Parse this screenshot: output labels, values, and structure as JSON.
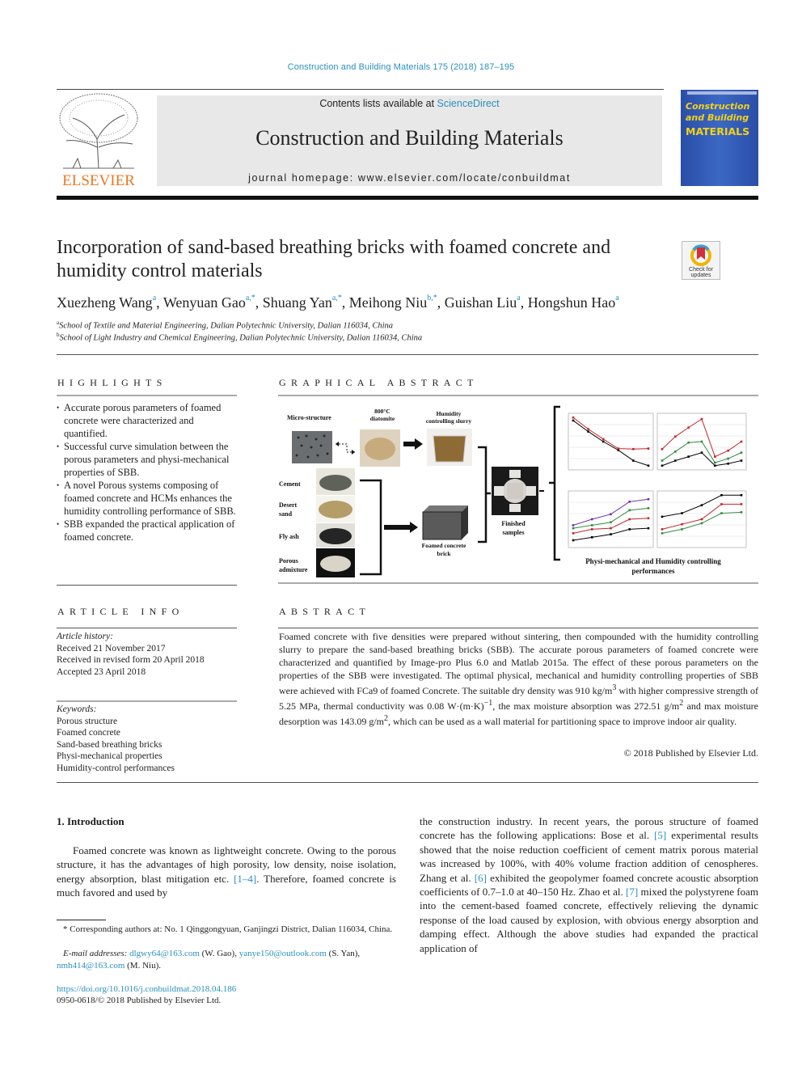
{
  "header": {
    "citation": "Construction and Building Materials 175 (2018) 187–195",
    "contents_prefix": "Contents lists available at ",
    "contents_link": "ScienceDirect",
    "journal_title": "Construction and Building Materials",
    "homepage": "journal homepage: www.elsevier.com/locate/conbuildmat",
    "publisher_logo": "ELSEVIER",
    "cover": {
      "line1": "Construction",
      "line2": "and Building",
      "line3": "MATERIALS"
    }
  },
  "article": {
    "title": "Incorporation of sand-based breathing bricks with foamed concrete and humidity control materials",
    "check_updates": "Check for updates",
    "authors": [
      {
        "name": "Xuezheng Wang",
        "sup": "a"
      },
      {
        "name": "Wenyuan Gao",
        "sup": "a,*"
      },
      {
        "name": "Shuang Yan",
        "sup": "a,*"
      },
      {
        "name": "Meihong Niu",
        "sup": "b,*"
      },
      {
        "name": "Guishan Liu",
        "sup": "a"
      },
      {
        "name": "Hongshun Hao",
        "sup": "a"
      }
    ],
    "affiliations": [
      {
        "mark": "a",
        "text": "School of Textile and Material Engineering, Dalian Polytechnic University, Dalian 116034, China"
      },
      {
        "mark": "b",
        "text": "School of Light Industry and Chemical Engineering, Dalian Polytechnic University, Dalian 116034, China"
      }
    ]
  },
  "highlights": {
    "heading": "HIGHLIGHTS",
    "items": [
      "Accurate porous parameters of foamed concrete were characterized and quantified.",
      "Successful curve simulation between the porous parameters and physi-mechanical properties of SBB.",
      "A novel Porous systems composing of foamed concrete and HCMs enhances the humidity controlling performance of SBB.",
      "SBB expanded the practical application of foamed concrete."
    ]
  },
  "article_info": {
    "heading": "ARTICLE INFO",
    "history_label": "Article history:",
    "history": [
      "Received 21 November 2017",
      "Received in revised form 20 April 2018",
      "Accepted 23 April 2018"
    ],
    "keywords_label": "Keywords:",
    "keywords": [
      "Porous structure",
      "Foamed concrete",
      "Sand-based breathing bricks",
      "Physi-mechanical properties",
      "Humidity-control performances"
    ]
  },
  "graphical_abstract": {
    "heading": "GRAPHICAL ABSTRACT",
    "labels": {
      "micro": "Micro-structure",
      "diatomite": "800°C diatomite",
      "slurry": "Humidity controlling slurry",
      "cement": "Cement",
      "desert_sand": "Desert sand",
      "fly_ash": "Fly ash",
      "porous": "Porous admixture",
      "brick": "Foamed concrete brick",
      "finished": "Finished samples",
      "caption": "Physi-mechanical and Humidity controlling performances"
    },
    "mini_charts": [
      {
        "series": [
          {
            "color": "#000000",
            "values": [
              0.92,
              0.7,
              0.5,
              0.33,
              0.12,
              0.02
            ]
          },
          {
            "color": "#c0262b",
            "values": [
              0.98,
              0.75,
              0.55,
              0.36,
              0.35,
              0.36
            ]
          }
        ]
      },
      {
        "series": [
          {
            "color": "#c0262b",
            "values": [
              0.35,
              0.6,
              0.78,
              0.95,
              0.2,
              0.32,
              0.5
            ]
          },
          {
            "color": "#2e8b3e",
            "values": [
              0.12,
              0.3,
              0.48,
              0.5,
              0.08,
              0.16,
              0.28
            ]
          },
          {
            "color": "#000000",
            "values": [
              0.02,
              0.12,
              0.2,
              0.28,
              0.02,
              0.06,
              0.12
            ]
          }
        ]
      },
      {
        "series": [
          {
            "color": "#6a2fb0",
            "values": [
              0.38,
              0.5,
              0.6,
              0.85,
              0.9
            ]
          },
          {
            "color": "#2e8b3e",
            "values": [
              0.32,
              0.38,
              0.44,
              0.68,
              0.72
            ]
          },
          {
            "color": "#c0262b",
            "values": [
              0.22,
              0.3,
              0.32,
              0.5,
              0.52
            ]
          },
          {
            "color": "#000000",
            "values": [
              0.08,
              0.14,
              0.2,
              0.3,
              0.32
            ]
          }
        ]
      },
      {
        "series": [
          {
            "color": "#000000",
            "values": [
              0.55,
              0.62,
              0.78,
              0.98,
              0.98
            ]
          },
          {
            "color": "#c0262b",
            "values": [
              0.3,
              0.4,
              0.5,
              0.8,
              0.8
            ]
          },
          {
            "color": "#2e8b3e",
            "values": [
              0.22,
              0.3,
              0.42,
              0.62,
              0.64
            ]
          }
        ]
      }
    ]
  },
  "abstract": {
    "heading": "ABSTRACT",
    "text_p1": "Foamed concrete with five densities were prepared without sintering, then compounded with the humidity controlling slurry to prepare the sand-based breathing bricks (SBB). The accurate porous parameters of foamed concrete were characterized and quantified by Image-pro Plus 6.0 and Matlab 2015a. The effect of these porous parameters on the properties of the SBB were investigated. The optimal physical, mechanical and humidity controlling properties of SBB were achieved with FCa9 of foamed Concrete. The suitable dry density was 910 kg/m",
    "t2": " with higher compressive strength of 5.25 MPa, thermal conductivity was 0.08 W·(m·K)",
    "t3": ", the max moisture absorption was 272.51 g/m",
    "t4": " and max moisture desorption was 143.09 g/m",
    "t5": ", which can be used as a wall material for partitioning space to improve indoor air quality.",
    "sup3": "3",
    "sup_neg1": "−1",
    "sup2": "2",
    "copyright": "© 2018 Published by Elsevier Ltd."
  },
  "intro": {
    "heading": "1. Introduction",
    "col1_a": "Foamed concrete was known as lightweight concrete. Owing to the porous structure, it has the advantages of high porosity, low density, noise isolation, energy absorption, blast mitigation etc. ",
    "ref1": "[1–4]",
    "col1_b": ". Therefore, foamed concrete is much favored and used by",
    "col2_a": "the construction industry. In recent years, the porous structure of foamed concrete has the following applications: Bose et al. ",
    "ref5": "[5]",
    "col2_b": " experimental results showed that the noise reduction coefficient of cement matrix porous material was increased by 100%, with 40% volume fraction addition of cenospheres. Zhang et al. ",
    "ref6": "[6]",
    "col2_c": " exhibited the geopolymer foamed concrete acoustic absorption coefficients of 0.7–1.0 at 40–150 Hz. Zhao et al. ",
    "ref7": "[7]",
    "col2_d": " mixed the polystyrene foam into the cement-based foamed concrete, effectively relieving the dynamic response of the load caused by explosion, with obvious energy absorption and damping effect. Although the above studies had expanded the practical application of"
  },
  "footnotes": {
    "corresponding": "* Corresponding authors at: No. 1 Qinggongyuan, Ganjingzi District, Dalian 116034, China.",
    "email_label": "E-mail addresses:",
    "emails": [
      {
        "addr": "dlgwy64@163.com",
        "who": " (W. Gao), "
      },
      {
        "addr": "yanye150@outlook.com",
        "who": " (S. Yan), "
      },
      {
        "addr": "nmh414@163.com",
        "who": " (M. Niu)."
      }
    ],
    "doi": "https://doi.org/10.1016/j.conbuildmat.2018.04.186",
    "issn": "0950-0618/© 2018 Published by Elsevier Ltd."
  }
}
